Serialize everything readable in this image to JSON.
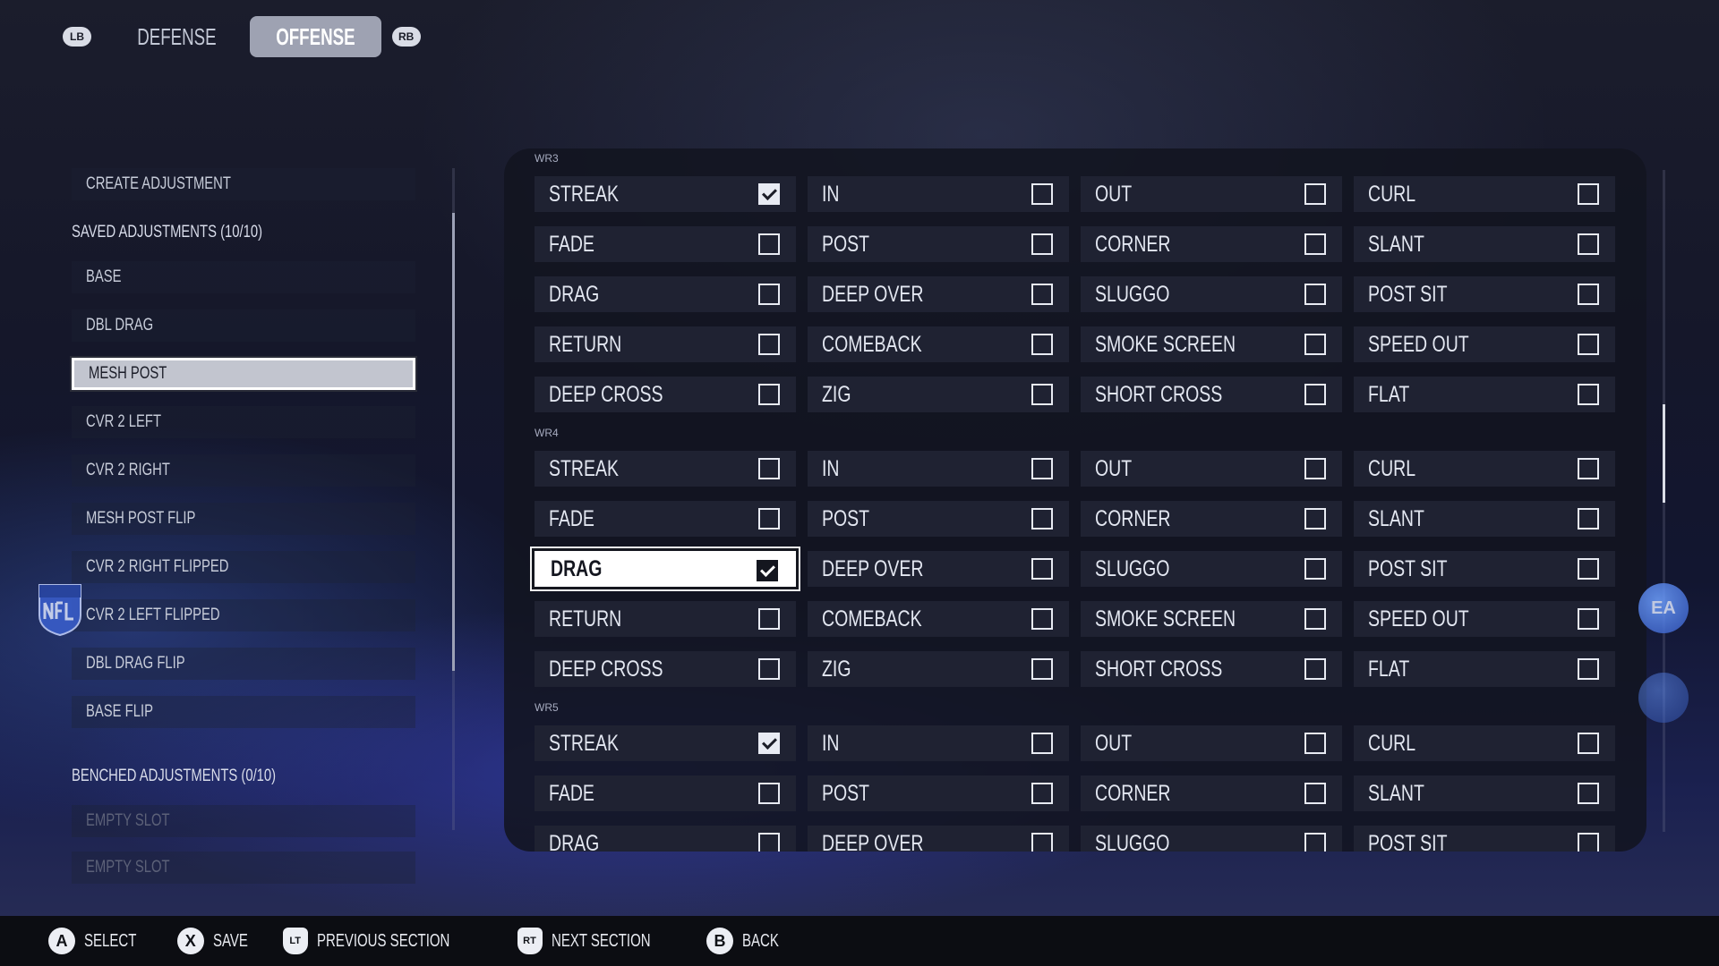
{
  "tabs": {
    "left_bumper": "LB",
    "right_bumper": "RB",
    "defense": "DEFENSE",
    "offense": "OFFENSE"
  },
  "left": {
    "create": "CREATE ADJUSTMENT",
    "saved_header": "SAVED ADJUSTMENTS (10/10)",
    "saved_items": [
      "BASE",
      "DBL DRAG",
      "MESH POST",
      "CVR 2 LEFT",
      "CVR 2 RIGHT",
      "MESH POST FLIP",
      "CVR 2 RIGHT FLIPPED",
      "CVR 2 LEFT FLIPPED",
      "DBL DRAG FLIP",
      "BASE FLIP"
    ],
    "selected": "MESH POST",
    "benched_header": "BENCHED ADJUSTMENTS (0/10)",
    "benched_items": [
      "EMPTY SLOT",
      "EMPTY SLOT"
    ]
  },
  "sections": [
    {
      "label": "WR3",
      "rows": [
        [
          {
            "label": "STREAK",
            "checked": true
          },
          {
            "label": "IN",
            "checked": false
          },
          {
            "label": "OUT",
            "checked": false
          },
          {
            "label": "CURL",
            "checked": false
          }
        ],
        [
          {
            "label": "FADE",
            "checked": false
          },
          {
            "label": "POST",
            "checked": false
          },
          {
            "label": "CORNER",
            "checked": false
          },
          {
            "label": "SLANT",
            "checked": false
          }
        ],
        [
          {
            "label": "DRAG",
            "checked": false
          },
          {
            "label": "DEEP OVER",
            "checked": false
          },
          {
            "label": "SLUGGO",
            "checked": false
          },
          {
            "label": "POST SIT",
            "checked": false
          }
        ],
        [
          {
            "label": "RETURN",
            "checked": false
          },
          {
            "label": "COMEBACK",
            "checked": false
          },
          {
            "label": "SMOKE SCREEN",
            "checked": false
          },
          {
            "label": "SPEED OUT",
            "checked": false
          }
        ],
        [
          {
            "label": "DEEP CROSS",
            "checked": false
          },
          {
            "label": "ZIG",
            "checked": false
          },
          {
            "label": "SHORT CROSS",
            "checked": false
          },
          {
            "label": "FLAT",
            "checked": false
          }
        ]
      ]
    },
    {
      "label": "WR4",
      "rows": [
        [
          {
            "label": "STREAK",
            "checked": false
          },
          {
            "label": "IN",
            "checked": false
          },
          {
            "label": "OUT",
            "checked": false
          },
          {
            "label": "CURL",
            "checked": false
          }
        ],
        [
          {
            "label": "FADE",
            "checked": false
          },
          {
            "label": "POST",
            "checked": false
          },
          {
            "label": "CORNER",
            "checked": false
          },
          {
            "label": "SLANT",
            "checked": false
          }
        ],
        [
          {
            "label": "DRAG",
            "checked": true,
            "focused": true
          },
          {
            "label": "DEEP OVER",
            "checked": false
          },
          {
            "label": "SLUGGO",
            "checked": false
          },
          {
            "label": "POST SIT",
            "checked": false
          }
        ],
        [
          {
            "label": "RETURN",
            "checked": false
          },
          {
            "label": "COMEBACK",
            "checked": false
          },
          {
            "label": "SMOKE SCREEN",
            "checked": false
          },
          {
            "label": "SPEED OUT",
            "checked": false
          }
        ],
        [
          {
            "label": "DEEP CROSS",
            "checked": false
          },
          {
            "label": "ZIG",
            "checked": false
          },
          {
            "label": "SHORT CROSS",
            "checked": false
          },
          {
            "label": "FLAT",
            "checked": false
          }
        ]
      ]
    },
    {
      "label": "WR5",
      "rows": [
        [
          {
            "label": "STREAK",
            "checked": true
          },
          {
            "label": "IN",
            "checked": false
          },
          {
            "label": "OUT",
            "checked": false
          },
          {
            "label": "CURL",
            "checked": false
          }
        ],
        [
          {
            "label": "FADE",
            "checked": false
          },
          {
            "label": "POST",
            "checked": false
          },
          {
            "label": "CORNER",
            "checked": false
          },
          {
            "label": "SLANT",
            "checked": false
          }
        ],
        [
          {
            "label": "DRAG",
            "checked": false
          },
          {
            "label": "DEEP OVER",
            "checked": false
          },
          {
            "label": "SLUGGO",
            "checked": false
          },
          {
            "label": "POST SIT",
            "checked": false
          }
        ]
      ]
    }
  ],
  "logos": {
    "ea": "EA"
  },
  "bottom": [
    {
      "key": "A",
      "label": "SELECT",
      "kind": "round"
    },
    {
      "key": "X",
      "label": "SAVE",
      "kind": "round"
    },
    {
      "key": "LT",
      "label": "PREVIOUS SECTION",
      "kind": "trigger"
    },
    {
      "key": "RT",
      "label": "NEXT SECTION",
      "kind": "trigger"
    },
    {
      "key": "B",
      "label": "BACK",
      "kind": "round"
    }
  ]
}
